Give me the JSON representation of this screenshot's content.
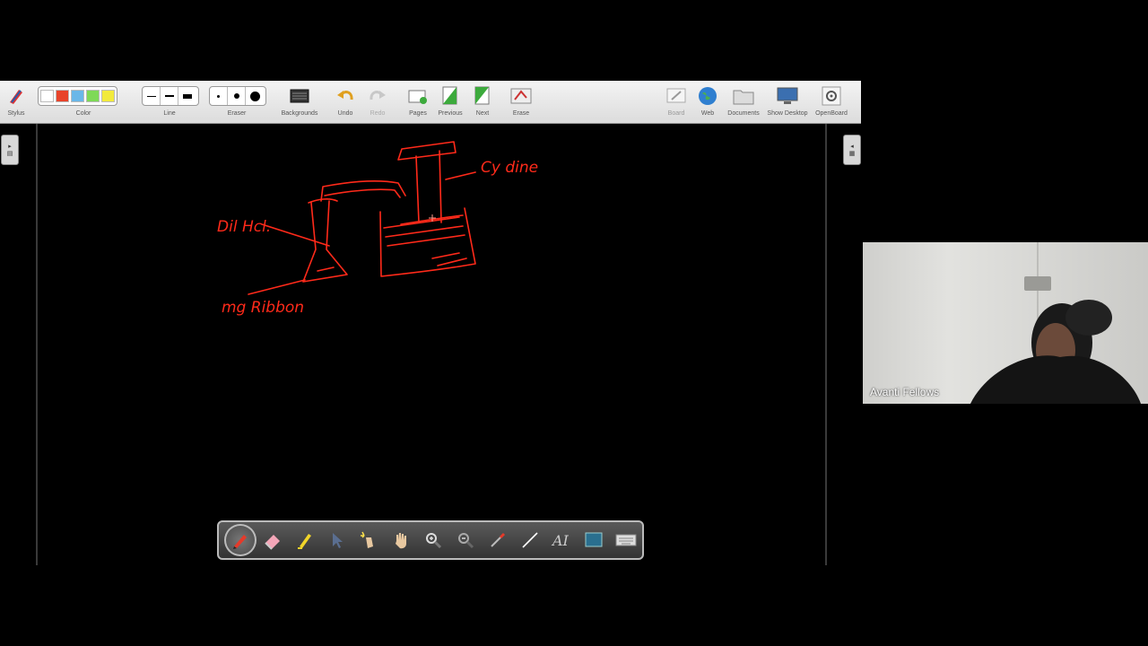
{
  "toolbar": {
    "stylus_label": "Stylus",
    "color_label": "Color",
    "line_label": "Line",
    "eraser_label": "Eraser",
    "backgrounds_label": "Backgrounds",
    "undo_label": "Undo",
    "redo_label": "Redo",
    "pages_label": "Pages",
    "previous_label": "Previous",
    "next_label": "Next",
    "erase_label": "Erase",
    "board_label": "Board",
    "web_label": "Web",
    "documents_label": "Documents",
    "show_desktop_label": "Show Desktop",
    "openboard_label": "OpenBoard",
    "colors": [
      "#ffffff",
      "#e8442a",
      "#6ab7e8",
      "#7ed957",
      "#f2ea3c"
    ]
  },
  "drawing": {
    "ink_color": "#ff2a1a",
    "labels": [
      "Dil Hcl.",
      "Cy dine",
      "mg Ribbon"
    ]
  },
  "stylus_palette": {
    "tools": [
      "pen-icon",
      "eraser-icon",
      "highlighter-icon",
      "pointer-icon",
      "laser-pointer-icon",
      "hand-icon",
      "zoom-in-icon",
      "zoom-out-icon",
      "color-picker-icon",
      "line-icon",
      "text-icon",
      "capture-icon",
      "keyboard-icon"
    ],
    "active_tool": "pen-icon"
  },
  "video": {
    "participant_name": "Avanti Fellows"
  }
}
